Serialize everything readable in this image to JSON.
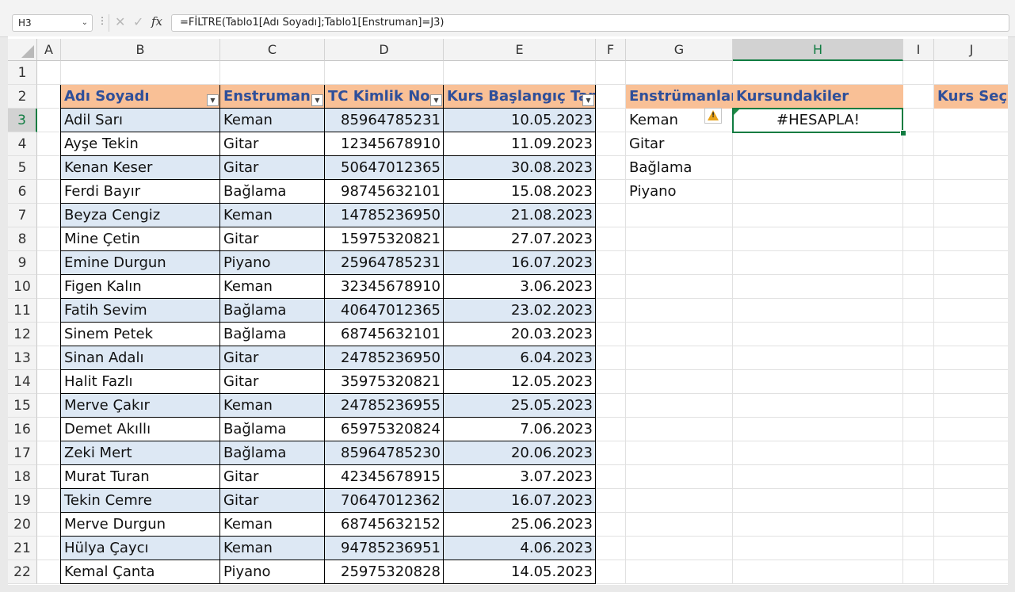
{
  "formula_bar": {
    "name_box": "H3",
    "formula": "=FİLTRE(Tablo1[Adı Soyadı];Tablo1[Enstruman]=J3)"
  },
  "columns": [
    "A",
    "B",
    "C",
    "D",
    "E",
    "F",
    "G",
    "H",
    "I",
    "J"
  ],
  "selected_column": "H",
  "rows": [
    "1",
    "2",
    "3",
    "4",
    "5",
    "6",
    "7",
    "8",
    "9",
    "10",
    "11",
    "12",
    "13",
    "14",
    "15",
    "16",
    "17",
    "18",
    "19",
    "20",
    "21",
    "22"
  ],
  "selected_row": "3",
  "table": {
    "headers": [
      "Adı Soyadı",
      "Enstruman",
      "TC Kimlik No",
      "Kurs Başlangıç Tarihi"
    ],
    "rows": [
      [
        "Adil Sarı",
        "Keman",
        "85964785231",
        "10.05.2023"
      ],
      [
        "Ayşe Tekin",
        "Gitar",
        "12345678910",
        "11.09.2023"
      ],
      [
        "Kenan Keser",
        "Gitar",
        "50647012365",
        "30.08.2023"
      ],
      [
        "Ferdi Bayır",
        "Bağlama",
        "98745632101",
        "15.08.2023"
      ],
      [
        "Beyza Cengiz",
        "Keman",
        "14785236950",
        "21.08.2023"
      ],
      [
        "Mine Çetin",
        "Gitar",
        "15975320821",
        "27.07.2023"
      ],
      [
        "Emine Durgun",
        "Piyano",
        "25964785231",
        "16.07.2023"
      ],
      [
        "Figen Kalın",
        "Keman",
        "32345678910",
        "3.06.2023"
      ],
      [
        "Fatih Sevim",
        "Bağlama",
        "40647012365",
        "23.02.2023"
      ],
      [
        "Sinem Petek",
        "Bağlama",
        "68745632101",
        "20.03.2023"
      ],
      [
        "Sinan Adalı",
        "Gitar",
        "24785236950",
        "6.04.2023"
      ],
      [
        "Halit Fazlı",
        "Gitar",
        "35975320821",
        "12.05.2023"
      ],
      [
        "Merve Çakır",
        "Keman",
        "24785236955",
        "25.05.2023"
      ],
      [
        "Demet Akıllı",
        "Bağlama",
        "65975320824",
        "7.06.2023"
      ],
      [
        "Zeki Mert",
        "Bağlama",
        "85964785230",
        "20.06.2023"
      ],
      [
        "Murat Turan",
        "Gitar",
        "42345678915",
        "3.07.2023"
      ],
      [
        "Tekin Cemre",
        "Gitar",
        "70647012362",
        "16.07.2023"
      ],
      [
        "Merve Durgun",
        "Keman",
        "68745632152",
        "25.06.2023"
      ],
      [
        "Hülya Çaycı",
        "Keman",
        "94785236951",
        "4.06.2023"
      ],
      [
        "Kemal Çanta",
        "Piyano",
        "25975320828",
        "14.05.2023"
      ]
    ]
  },
  "instruments": {
    "header": "Enstrümanlar",
    "items": [
      "Keman",
      "Gitar",
      "Bağlama",
      "Piyano"
    ]
  },
  "result": {
    "header": "Kursundakiler",
    "value": "#HESAPLA!"
  },
  "course_select": {
    "header": "Kurs Seç",
    "value": ""
  },
  "colors": {
    "header_fill": "#f9c096",
    "header_text": "#2f4f9a",
    "band_fill": "#dde8f4",
    "selection": "#107c41"
  },
  "icons": [
    "chevron-down-icon",
    "more-dots-icon",
    "cancel-x-icon",
    "enter-check-icon",
    "fx-icon",
    "filter-dropdown-icon",
    "warning-icon",
    "error-indicator-icon"
  ]
}
